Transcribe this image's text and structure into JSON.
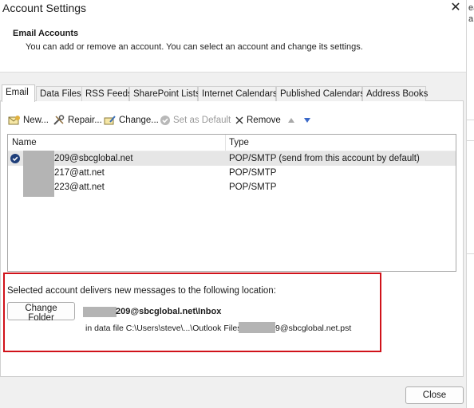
{
  "window": {
    "title": "Account Settings",
    "close_glyph": "✕"
  },
  "header": {
    "title": "Email Accounts",
    "description": "You can add or remove an account. You can select an account and change its settings."
  },
  "tabs": [
    {
      "label": "Email",
      "active": true
    },
    {
      "label": "Data Files"
    },
    {
      "label": "RSS Feeds"
    },
    {
      "label": "SharePoint Lists"
    },
    {
      "label": "Internet Calendars"
    },
    {
      "label": "Published Calendars"
    },
    {
      "label": "Address Books"
    }
  ],
  "toolbar": {
    "new_label": "New...",
    "repair_label": "Repair...",
    "change_label": "Change...",
    "set_default_label": "Set as Default",
    "remove_label": "Remove",
    "icons": [
      "new-account-icon",
      "repair-icon",
      "change-icon",
      "set-default-check-icon",
      "remove-x-icon",
      "move-up-icon",
      "move-down-icon"
    ]
  },
  "accounts": {
    "columns": [
      "Name",
      "Type"
    ],
    "rows": [
      {
        "name": "209@sbcglobal.net",
        "type": "POP/SMTP (send from this account by default)",
        "default": true
      },
      {
        "name": "217@att.net",
        "type": "POP/SMTP"
      },
      {
        "name": "223@att.net",
        "type": "POP/SMTP"
      }
    ]
  },
  "delivery": {
    "label": "Selected account delivers new messages to the following location:",
    "change_folder_label": "Change Folder",
    "folder_path": "209@sbcglobal.net\\Inbox",
    "data_file_prefix": "in data file C:\\Users\\steve\\...\\Outlook Files\\s",
    "data_file_suffix": "9@sbcglobal.net.pst"
  },
  "footer": {
    "close_label": "Close"
  },
  "background_window": {
    "fragments": [
      "ea",
      "a"
    ]
  },
  "colors": {
    "highlight_box": "#d0121a",
    "selected_row": "#e6e6e6",
    "default_check": "#1f3f7a",
    "redaction": "#b4b4b4"
  }
}
